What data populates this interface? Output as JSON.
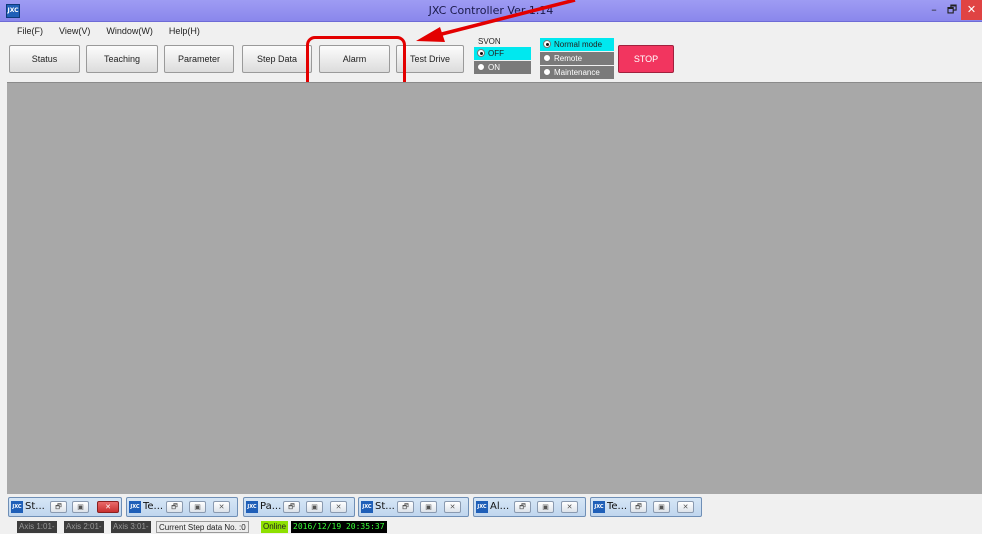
{
  "window": {
    "title": "JXC Controller Ver 1.14",
    "app_icon": "JXC",
    "minimize": "–",
    "restore": "🗗",
    "close": "✕"
  },
  "menu": [
    "File(F)",
    "View(V)",
    "Window(W)",
    "Help(H)"
  ],
  "toolbar": {
    "status": "Status",
    "teaching": "Teaching",
    "parameter": "Parameter",
    "step_data": "Step Data",
    "alarm": "Alarm",
    "test_drive": "Test Drive"
  },
  "svon": {
    "label": "SVON",
    "off": "OFF",
    "on": "ON",
    "selected": "OFF",
    "highlight_color": "#00e8ef"
  },
  "mode": {
    "normal": "Normal mode",
    "remote": "Remote",
    "maintenance": "Maintenance",
    "selected": "Normal mode"
  },
  "stop": {
    "label": "STOP",
    "color": "#f2355f"
  },
  "minimized_windows": [
    {
      "title": "St...",
      "icon": "JXC"
    },
    {
      "title": "Te...",
      "icon": "JXC"
    },
    {
      "title": "Pa...",
      "icon": "JXC"
    },
    {
      "title": "St...",
      "icon": "JXC"
    },
    {
      "title": "Al...",
      "icon": "JXC"
    },
    {
      "title": "Te...",
      "icon": "JXC"
    }
  ],
  "status_bar": {
    "axis1": "Axis 1:01-",
    "axis2": "Axis 2:01-",
    "axis3": "Axis 3:01-",
    "step": "Current Step data No. :0",
    "online": "Online",
    "timestamp": "2016/12/19 20:35:37"
  },
  "annotation": {
    "color": "#e30000"
  },
  "colors": {
    "titlebar": "#8a87ec",
    "workspace": "#a8a8a8",
    "online_bg": "#8ee000",
    "timestamp_bg": "#000000",
    "timestamp_fg": "#3aff3a"
  }
}
